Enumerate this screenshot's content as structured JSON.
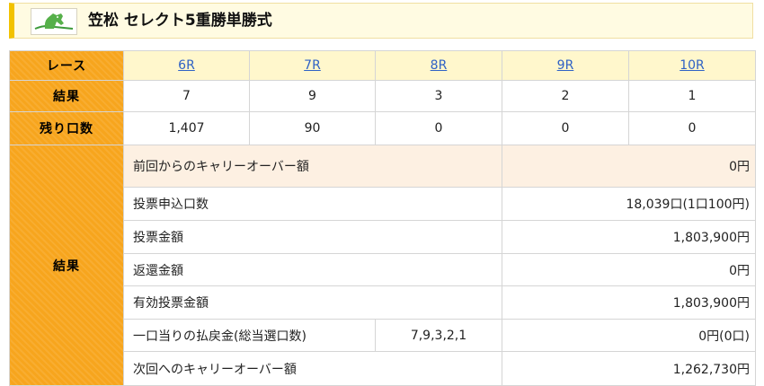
{
  "header": {
    "title": "笠松 セレクト5重勝単勝式",
    "accent_color": "#f2c200",
    "logo_icon": "horse-head-logo-icon"
  },
  "races": {
    "label": "レース",
    "items": [
      "6R",
      "7R",
      "8R",
      "9R",
      "10R"
    ]
  },
  "results_row": {
    "label": "結果",
    "values": [
      "7",
      "9",
      "3",
      "2",
      "1"
    ]
  },
  "remaining_row": {
    "label": "残り口数",
    "values": [
      "1,407",
      "90",
      "0",
      "0",
      "0"
    ]
  },
  "summary": {
    "label": "結果",
    "carryover_in": {
      "label": "前回からのキャリーオーバー額",
      "value": "0円"
    },
    "tickets": {
      "label": "投票申込口数",
      "value": "18,039口(1口100円)"
    },
    "vote_amount": {
      "label": "投票金額",
      "value": "1,803,900円"
    },
    "refund": {
      "label": "返還金額",
      "value": "0円"
    },
    "valid_amount": {
      "label": "有効投票金額",
      "value": "1,803,900円"
    },
    "payout": {
      "label": "一口当りの払戻金(総当選口数)",
      "combo": "7,9,3,2,1",
      "value": "0円(0口)"
    },
    "carryover_out": {
      "label": "次回へのキャリーオーバー額",
      "value": "1,262,730円"
    }
  },
  "colors": {
    "label_bg": "#f7a51d",
    "race_header_bg": "#fff7cc",
    "link": "#2f62c5",
    "carryover_row_bg": "#fdf0e2"
  }
}
